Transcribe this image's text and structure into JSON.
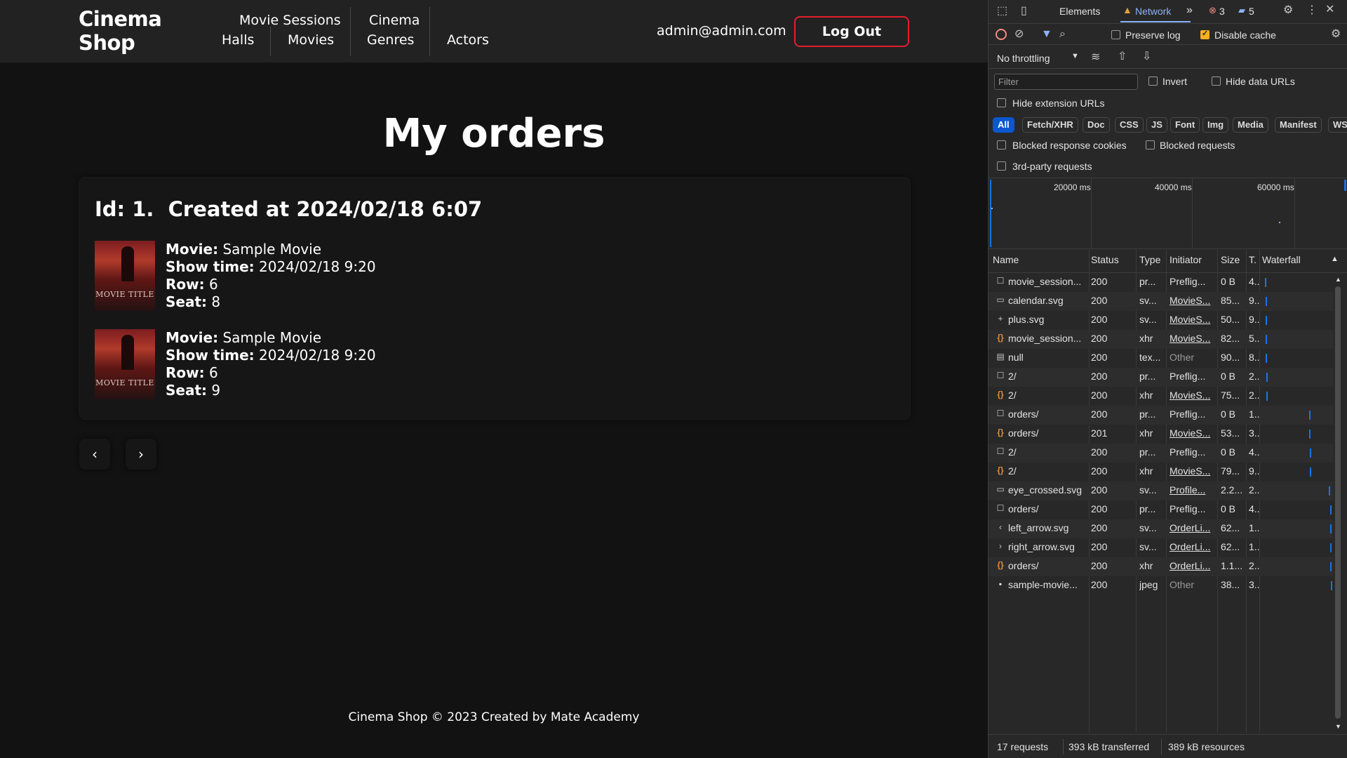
{
  "app": {
    "logo": [
      "Cinema",
      "Shop"
    ],
    "nav": {
      "movie_sessions": "Movie Sessions",
      "halls": "Halls",
      "movies": "Movies",
      "cinema": "Cinema",
      "genres": "Genres",
      "actors": "Actors"
    },
    "user_email": "admin@admin.com",
    "logout_label": "Log Out",
    "page_title": "My orders",
    "order": {
      "title": "Id: 1.  Created at 2024/02/18 6:07",
      "tickets": [
        {
          "movie_label": "Movie:",
          "movie": "Sample Movie",
          "showtime_label": "Show time:",
          "showtime": "2024/02/18 9:20",
          "row_label": "Row:",
          "row": "6",
          "seat_label": "Seat:",
          "seat": "8",
          "poster_text": "MOVIE TITLE"
        },
        {
          "movie_label": "Movie:",
          "movie": "Sample Movie",
          "showtime_label": "Show time:",
          "showtime": "2024/02/18 9:20",
          "row_label": "Row:",
          "row": "6",
          "seat_label": "Seat:",
          "seat": "9",
          "poster_text": "MOVIE TITLE"
        }
      ]
    },
    "pager": {
      "prev_icon": "‹",
      "next_icon": "›"
    },
    "footer": "Cinema Shop © 2023 Created by Mate Academy"
  },
  "devtools": {
    "tabs": {
      "elements": "Elements",
      "network": "Network",
      "more": "»"
    },
    "badges": {
      "errors": "3",
      "messages": "5"
    },
    "toolbar": {
      "preserve_log": "Preserve log",
      "disable_cache": "Disable cache",
      "disable_cache_checked": true,
      "preserve_log_checked": false,
      "throttling": "No throttling"
    },
    "filter": {
      "placeholder": "Filter",
      "invert": "Invert",
      "hide_data_urls": "Hide data URLs",
      "hide_extension_urls": "Hide extension URLs"
    },
    "chips": [
      "All",
      "Fetch/XHR",
      "Doc",
      "CSS",
      "JS",
      "Font",
      "Img",
      "Media",
      "Manifest",
      "WS"
    ],
    "checks": {
      "blocked_cookies": "Blocked response cookies",
      "blocked_requests": "Blocked requests",
      "third_party": "3rd-party requests"
    },
    "timeline_labels": [
      "20000 ms",
      "40000 ms",
      "60000 ms"
    ],
    "columns": {
      "name": "Name",
      "status": "Status",
      "type": "Type",
      "initiator": "Initiator",
      "size": "Size",
      "time": "T.",
      "waterfall": "Waterfall"
    },
    "requests": [
      {
        "icon": "☐",
        "kind": "pf",
        "name": "movie_session...",
        "status": "200",
        "type": "pr...",
        "initiator": "Preflig...",
        "init_style": "plain",
        "size": "0 B",
        "time": "4..",
        "wf": 0.02
      },
      {
        "icon": "▭",
        "kind": "pf",
        "name": "calendar.svg",
        "status": "200",
        "type": "sv...",
        "initiator": "MovieS...",
        "init_style": "link",
        "size": "85...",
        "time": "9..",
        "wf": 0.03
      },
      {
        "icon": "+",
        "kind": "pf",
        "name": "plus.svg",
        "status": "200",
        "type": "sv...",
        "initiator": "MovieS...",
        "init_style": "link",
        "size": "50...",
        "time": "9..",
        "wf": 0.03
      },
      {
        "icon": "{}",
        "kind": "xhr",
        "name": "movie_session...",
        "status": "200",
        "type": "xhr",
        "initiator": "MovieS...",
        "init_style": "link",
        "size": "82...",
        "time": "5..",
        "wf": 0.03
      },
      {
        "icon": "▤",
        "kind": "pf",
        "name": "null",
        "status": "200",
        "type": "tex...",
        "initiator": "Other",
        "init_style": "dim",
        "size": "90...",
        "time": "8..",
        "wf": 0.03
      },
      {
        "icon": "☐",
        "kind": "pf",
        "name": "2/",
        "status": "200",
        "type": "pr...",
        "initiator": "Preflig...",
        "init_style": "plain",
        "size": "0 B",
        "time": "2..",
        "wf": 0.04
      },
      {
        "icon": "{}",
        "kind": "xhr",
        "name": "2/",
        "status": "200",
        "type": "xhr",
        "initiator": "MovieS...",
        "init_style": "link",
        "size": "75...",
        "time": "2..",
        "wf": 0.04
      },
      {
        "icon": "☐",
        "kind": "pf",
        "name": "orders/",
        "status": "200",
        "type": "pr...",
        "initiator": "Preflig...",
        "init_style": "plain",
        "size": "0 B",
        "time": "1..",
        "wf": 0.68
      },
      {
        "icon": "{}",
        "kind": "xhr",
        "name": "orders/",
        "status": "201",
        "type": "xhr",
        "initiator": "MovieS...",
        "init_style": "link",
        "size": "53...",
        "time": "3..",
        "wf": 0.68
      },
      {
        "icon": "☐",
        "kind": "pf",
        "name": "2/",
        "status": "200",
        "type": "pr...",
        "initiator": "Preflig...",
        "init_style": "plain",
        "size": "0 B",
        "time": "4..",
        "wf": 0.69
      },
      {
        "icon": "{}",
        "kind": "xhr",
        "name": "2/",
        "status": "200",
        "type": "xhr",
        "initiator": "MovieS...",
        "init_style": "link",
        "size": "79...",
        "time": "9..",
        "wf": 0.69
      },
      {
        "icon": "▭",
        "kind": "pf",
        "name": "eye_crossed.svg",
        "status": "200",
        "type": "sv...",
        "initiator": "Profile...",
        "init_style": "link",
        "size": "2.2...",
        "time": "2..",
        "wf": 0.97
      },
      {
        "icon": "☐",
        "kind": "pf",
        "name": "orders/",
        "status": "200",
        "type": "pr...",
        "initiator": "Preflig...",
        "init_style": "plain",
        "size": "0 B",
        "time": "4..",
        "wf": 0.99
      },
      {
        "icon": "‹",
        "kind": "pf",
        "name": "left_arrow.svg",
        "status": "200",
        "type": "sv...",
        "initiator": "OrderLi...",
        "init_style": "link",
        "size": "62...",
        "time": "1..",
        "wf": 0.99
      },
      {
        "icon": "›",
        "kind": "pf",
        "name": "right_arrow.svg",
        "status": "200",
        "type": "sv...",
        "initiator": "OrderLi...",
        "init_style": "link",
        "size": "62...",
        "time": "1..",
        "wf": 0.99
      },
      {
        "icon": "{}",
        "kind": "xhr",
        "name": "orders/",
        "status": "200",
        "type": "xhr",
        "initiator": "OrderLi...",
        "init_style": "link",
        "size": "1.1...",
        "time": "2..",
        "wf": 0.99
      },
      {
        "icon": "▪",
        "kind": "img",
        "name": "sample-movie...",
        "status": "200",
        "type": "jpeg",
        "initiator": "Other",
        "init_style": "dim",
        "size": "38...",
        "time": "3..",
        "wf": 1.0
      }
    ],
    "status_bar": {
      "requests": "17 requests",
      "transferred": "393 kB transferred",
      "resources": "389 kB resources"
    }
  }
}
